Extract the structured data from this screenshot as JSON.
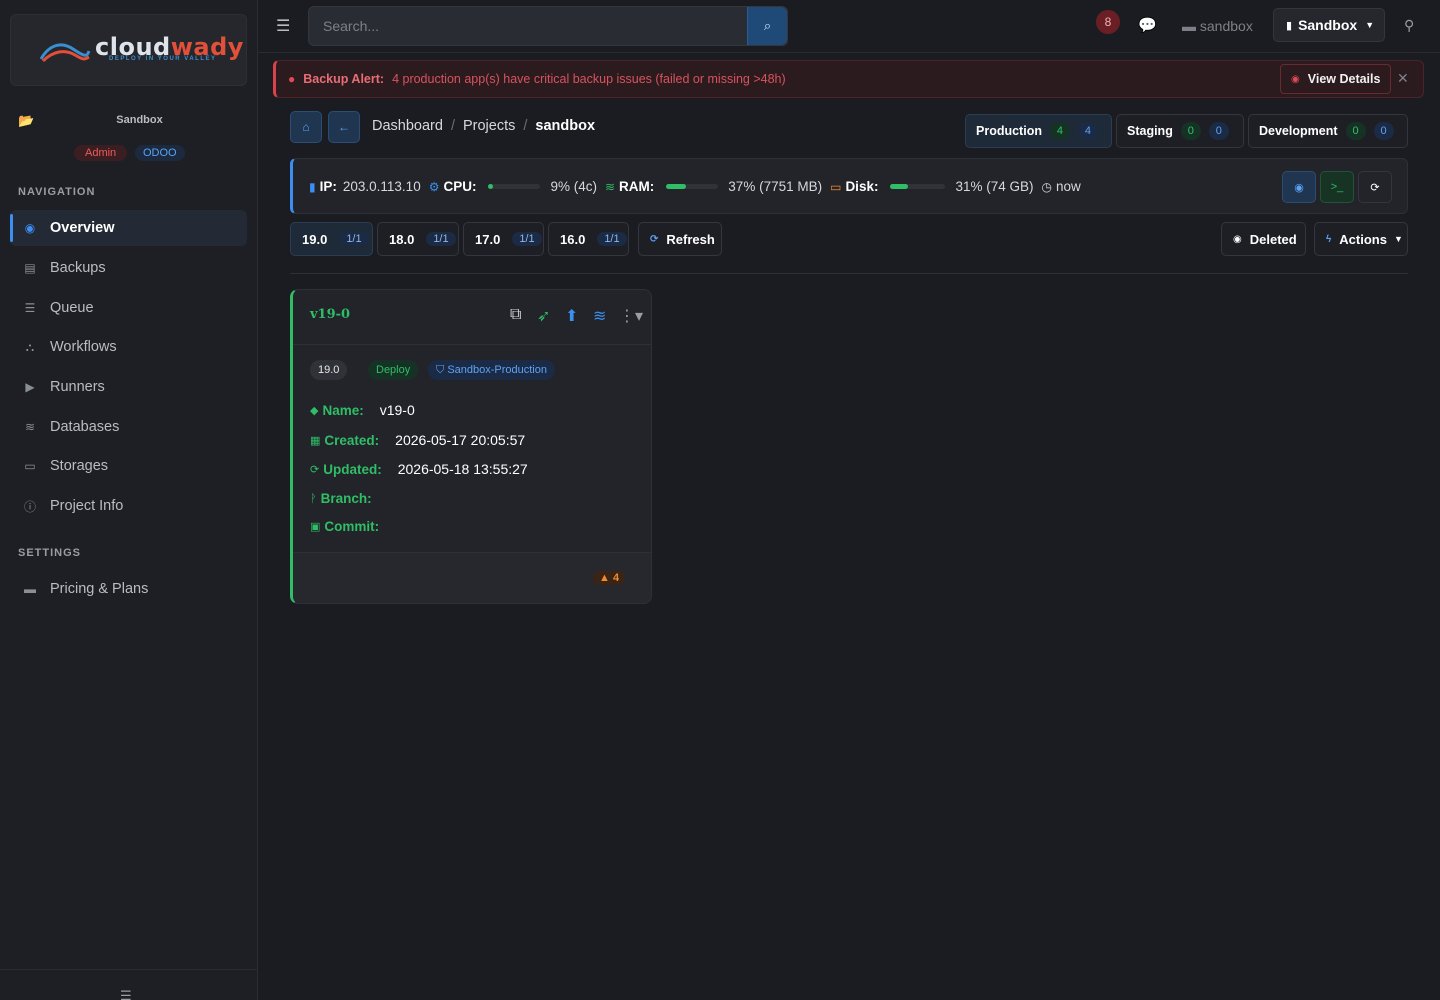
{
  "brand": {
    "name_part1": "cloud",
    "name_part2": "wady",
    "tagline": "DEPLOY IN YOUR VALLEY"
  },
  "sidebar": {
    "project_name": "Sandbox",
    "badges": {
      "role": "Admin",
      "platform": "ODOO"
    },
    "nav_section_title": "NAVIGATION",
    "nav_items": [
      {
        "label": "Overview",
        "icon": "dashboard-icon",
        "active": true
      },
      {
        "label": "Backups",
        "icon": "archive-icon"
      },
      {
        "label": "Queue",
        "icon": "list-icon"
      },
      {
        "label": "Workflows",
        "icon": "sitemap-icon"
      },
      {
        "label": "Runners",
        "icon": "play-circle-icon"
      },
      {
        "label": "Databases",
        "icon": "database-icon"
      },
      {
        "label": "Storages",
        "icon": "hdd-icon"
      },
      {
        "label": "Project Info",
        "icon": "info-icon"
      }
    ],
    "settings_section_title": "SETTINGS",
    "settings_items": [
      {
        "label": "Pricing & Plans",
        "icon": "credit-card-icon"
      }
    ]
  },
  "topbar": {
    "search_placeholder": "Search...",
    "notification_count": "8",
    "folder_label": "sandbox",
    "env_select": "Sandbox"
  },
  "alert": {
    "title": "Backup Alert:",
    "message": "4 production app(s) have critical backup issues (failed or missing >48h)",
    "button": "View Details"
  },
  "breadcrumb": {
    "items": [
      "Dashboard",
      "Projects"
    ],
    "current": "sandbox"
  },
  "env_tabs": [
    {
      "label": "Production",
      "green": "4",
      "blue": "4",
      "active": true
    },
    {
      "label": "Staging",
      "green": "0",
      "blue": "0"
    },
    {
      "label": "Development",
      "green": "0",
      "blue": "0"
    }
  ],
  "server": {
    "ip_label": "IP:",
    "ip": "203.0.113.10",
    "cpu_label": "CPU:",
    "cpu_value": "9% (4c)",
    "cpu_pct": 9,
    "ram_label": "RAM:",
    "ram_value": "37% (7751 MB)",
    "ram_pct": 37,
    "disk_label": "Disk:",
    "disk_value": "31% (74 GB)",
    "disk_pct": 31,
    "updated": "now"
  },
  "versions": [
    {
      "label": "19.0",
      "count": "1/1",
      "active": true
    },
    {
      "label": "18.0",
      "count": "1/1"
    },
    {
      "label": "17.0",
      "count": "1/1"
    },
    {
      "label": "16.0",
      "count": "1/1"
    }
  ],
  "actions": {
    "refresh": "Refresh",
    "deleted": "Deleted",
    "actions": "Actions"
  },
  "app_card": {
    "title": "v19-0",
    "tags": {
      "version": "19.0",
      "status": "Deploy",
      "env": "Sandbox-Production"
    },
    "fields": {
      "name_label": "Name:",
      "name": "v19-0",
      "created_label": "Created:",
      "created": "2026-05-17 20:05:57",
      "updated_label": "Updated:",
      "updated": "2026-05-18 13:55:27",
      "branch_label": "Branch:",
      "commit_label": "Commit:"
    },
    "warning_count": "4"
  },
  "colors": {
    "accent": "#3b8ff0",
    "success": "#2fbe66",
    "danger": "#e14a55",
    "brand_red": "#e2503a"
  }
}
